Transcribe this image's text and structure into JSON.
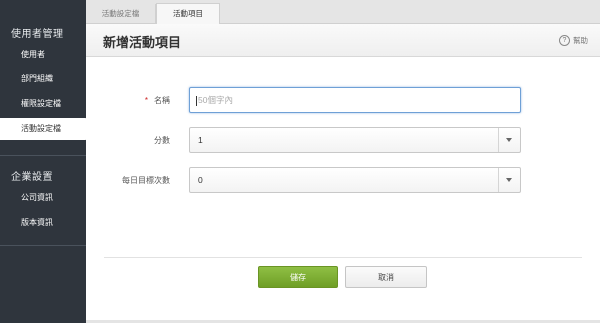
{
  "sidebar": {
    "section1": "使用者管理",
    "items1": [
      "使用者",
      "部門組織",
      "權限設定檔",
      "活動設定檔"
    ],
    "section2": "企業設置",
    "items2": [
      "公司資訊",
      "版本資訊"
    ],
    "active_index": 3
  },
  "tabs": [
    "活動設定檔",
    "活動項目"
  ],
  "header": {
    "title": "新增活動項目",
    "help_label": "幫助",
    "help_icon": "question-circle-icon"
  },
  "form": {
    "name_label": "名稱",
    "name_required_mark": "*",
    "name_placeholder": "50個字內",
    "score_label": "分數",
    "score_value": "1",
    "daily_label": "每日目標次數",
    "daily_value": "0"
  },
  "buttons": {
    "save": "儲存",
    "cancel": "取消"
  },
  "colors": {
    "sidebar_bg": "#2f353d",
    "save_green": "#7aab30",
    "focus_blue": "#6fa0d6"
  }
}
